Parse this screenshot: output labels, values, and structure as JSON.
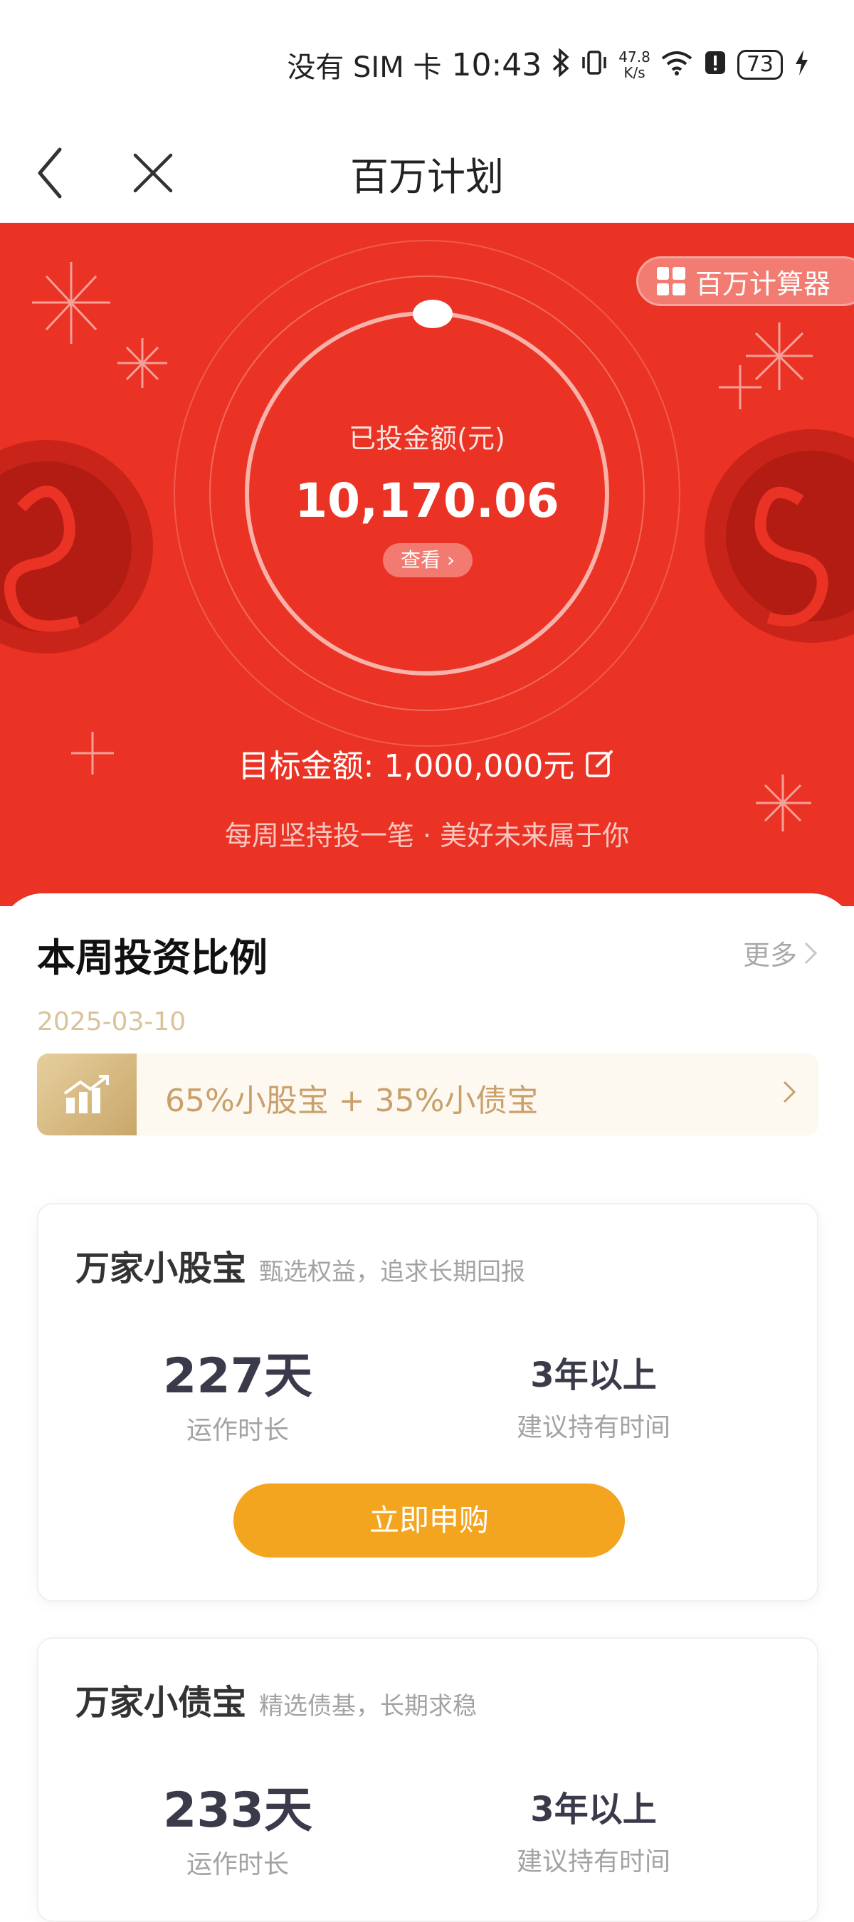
{
  "status_bar": {
    "sim": "没有 SIM 卡",
    "time": "10:43",
    "net_speed_value": "47.8",
    "net_speed_unit": "K/s",
    "battery": "73",
    "icons": [
      "bluetooth-icon",
      "vibrate-icon",
      "wifi-icon",
      "alert-icon",
      "battery-icon",
      "charging-icon"
    ]
  },
  "nav": {
    "title": "百万计划",
    "icons": [
      "back-chevron-icon",
      "close-icon"
    ]
  },
  "hero": {
    "calculator_label": "百万计算器",
    "invested_label": "已投金额(元)",
    "invested_amount": "10,170.06",
    "view_label": "查看 ›",
    "target_label": "目标金额:",
    "target_value": "1,000,000元",
    "slogan": "每周坚持投一笔 · 美好未来属于你",
    "progress_fraction": 0.0102,
    "colors": {
      "background": "#ea3324",
      "accent_light": "#f37a70"
    }
  },
  "weekly": {
    "title": "本周投资比例",
    "more_label": "更多",
    "date": "2025-03-10",
    "ratio_text": "65%小股宝 + 35%小债宝",
    "ratio_icon": "trend-chart-icon"
  },
  "funds": [
    {
      "name": "万家小股宝",
      "desc": "甄选权益，追求长期回报",
      "duration_value": "227天",
      "duration_label": "运作时长",
      "hold_value": "3年以上",
      "hold_label": "建议持有时间",
      "button_label": "立即申购"
    },
    {
      "name": "万家小债宝",
      "desc": "精选债基，长期求稳",
      "duration_value": "233天",
      "duration_label": "运作时长",
      "hold_value": "3年以上",
      "hold_label": "建议持有时间"
    }
  ],
  "colors": {
    "gold": "#c9a06a",
    "button_orange": "#f4a51f"
  }
}
